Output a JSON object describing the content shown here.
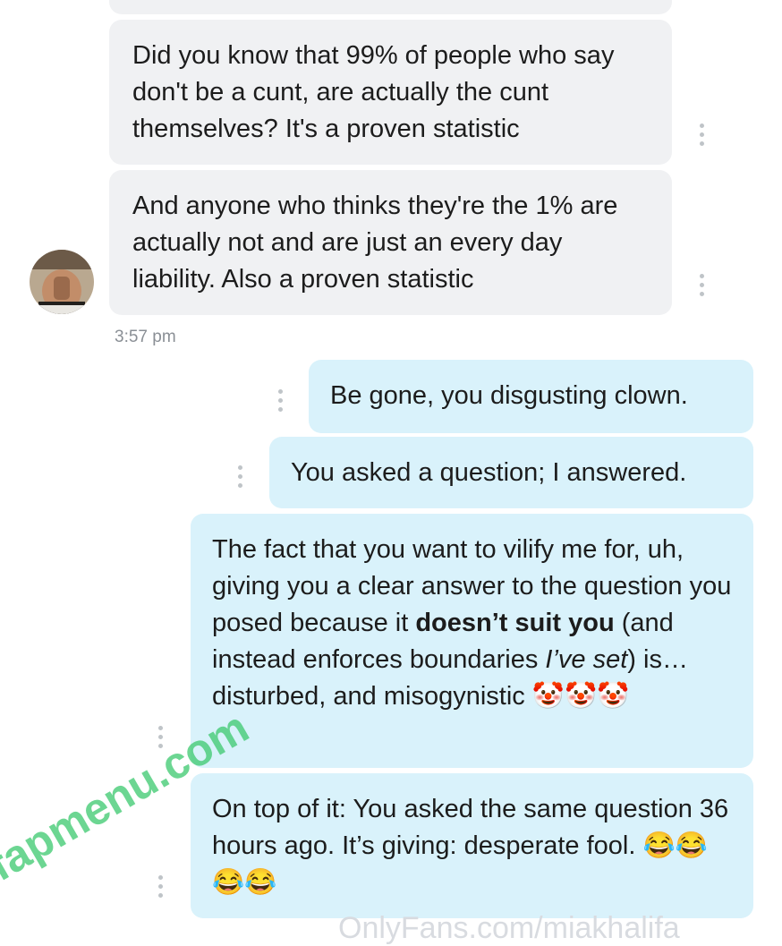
{
  "chat": {
    "incoming": [
      {
        "text": "Did you know that 99% of people who say don't be a cunt, are actually the cunt themselves? It's a proven statistic"
      },
      {
        "text": "And anyone who thinks they're the 1% are actually not and are just an every day liability. Also a proven statistic"
      }
    ],
    "timestamp": "3:57 pm",
    "outgoing": [
      {
        "text": "Be gone, you disgusting clown."
      },
      {
        "text": "You asked a question; I answered."
      },
      {
        "p1": "The fact that you want to vilify me for, uh, giving you a clear answer to the question you posed because it ",
        "b1": "doesn’t suit you",
        "p2": " (and instead enforces boundaries ",
        "i1": "I’ve set",
        "p3": ") is… disturbed, and misogynistic ",
        "emoji": "🤡🤡🤡"
      },
      {
        "text": "On top of it: You asked the same question 36 hours ago. It’s giving: desperate fool. ",
        "emoji": "😂😂😂😂"
      }
    ]
  },
  "watermarks": {
    "site": "fapmenu.com",
    "bottom": "OnlyFans.com/miakhalifa"
  },
  "colors": {
    "incoming_bubble": "#f0f1f3",
    "outgoing_bubble": "#d9f2fb",
    "watermark": "#3cc96e"
  }
}
